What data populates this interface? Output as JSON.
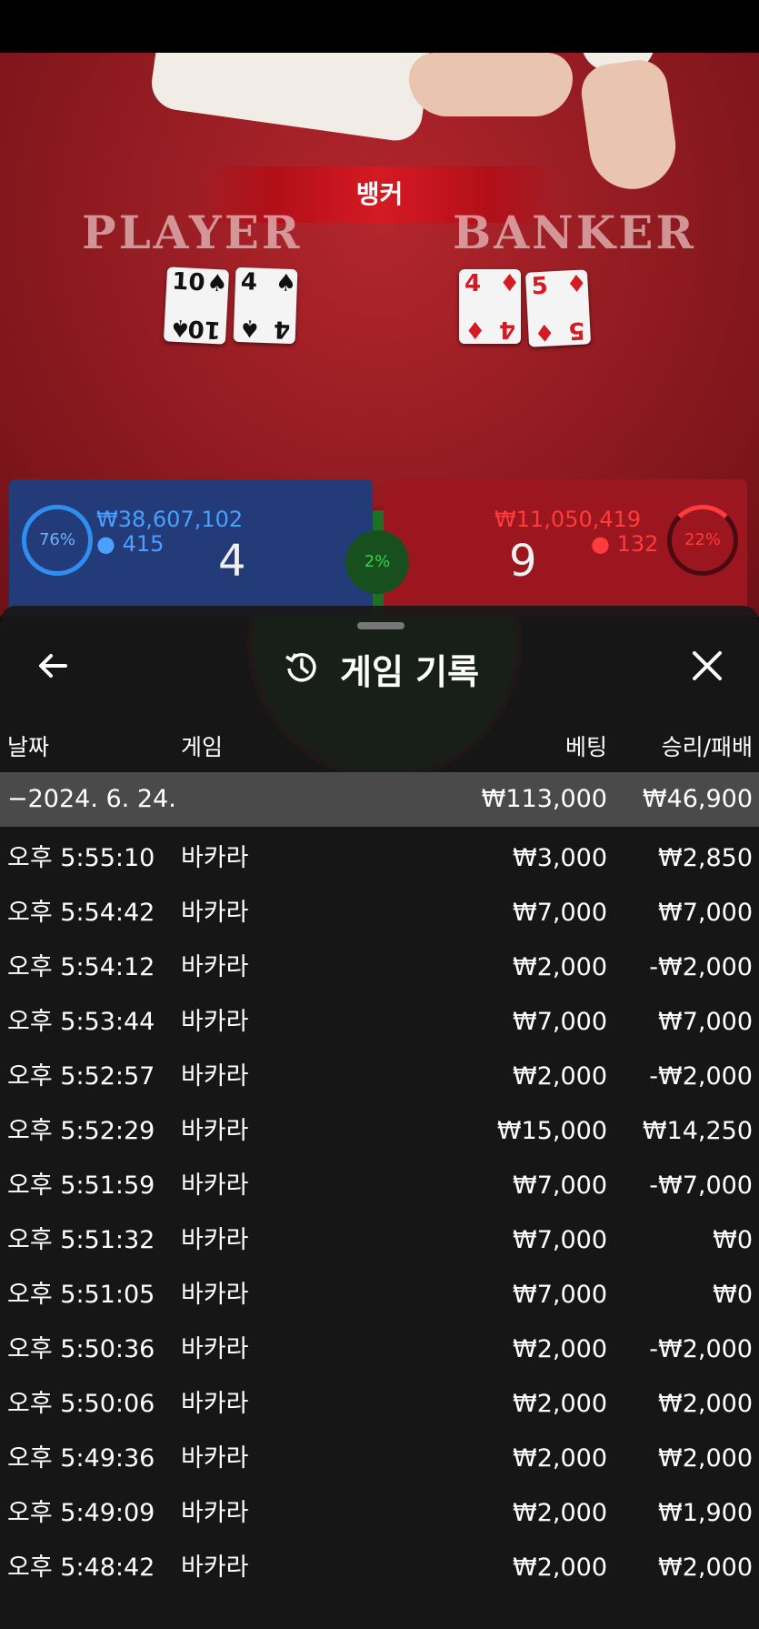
{
  "game_table": {
    "result_banner": "뱅커",
    "player_label": "PLAYER",
    "banker_label": "BANKER",
    "player_cards": [
      {
        "rank": "10",
        "suit": "♠",
        "color": "black"
      },
      {
        "rank": "4",
        "suit": "♠",
        "color": "black"
      }
    ],
    "banker_cards": [
      {
        "rank": "4",
        "suit": "♦",
        "color": "red"
      },
      {
        "rank": "5",
        "suit": "♦",
        "color": "red"
      }
    ],
    "player_stats": {
      "percent": "76%",
      "amount": "₩38,607,102",
      "bettors": "415",
      "score": "4"
    },
    "banker_stats": {
      "percent": "22%",
      "amount": "₩11,050,419",
      "bettors": "132",
      "score": "9"
    },
    "tie_percent": "2%"
  },
  "sheet": {
    "title": "게임 기록",
    "back_icon": "arrow-left-icon",
    "history_icon": "history-icon",
    "close_icon": "close-icon",
    "columns": {
      "date": "날짜",
      "game": "게임",
      "bet": "베팅",
      "result": "승리/패배"
    },
    "total_row": {
      "date": "−2024. 6. 24.",
      "bet": "₩113,000",
      "result": "₩46,900"
    },
    "rows": [
      {
        "time": "오후 5:55:10",
        "game": "바카라",
        "bet": "₩3,000",
        "result": "₩2,850"
      },
      {
        "time": "오후 5:54:42",
        "game": "바카라",
        "bet": "₩7,000",
        "result": "₩7,000"
      },
      {
        "time": "오후 5:54:12",
        "game": "바카라",
        "bet": "₩2,000",
        "result": "-₩2,000"
      },
      {
        "time": "오후 5:53:44",
        "game": "바카라",
        "bet": "₩7,000",
        "result": "₩7,000"
      },
      {
        "time": "오후 5:52:57",
        "game": "바카라",
        "bet": "₩2,000",
        "result": "-₩2,000"
      },
      {
        "time": "오후 5:52:29",
        "game": "바카라",
        "bet": "₩15,000",
        "result": "₩14,250"
      },
      {
        "time": "오후 5:51:59",
        "game": "바카라",
        "bet": "₩7,000",
        "result": "-₩7,000"
      },
      {
        "time": "오후 5:51:32",
        "game": "바카라",
        "bet": "₩7,000",
        "result": "₩0"
      },
      {
        "time": "오후 5:51:05",
        "game": "바카라",
        "bet": "₩7,000",
        "result": "₩0"
      },
      {
        "time": "오후 5:50:36",
        "game": "바카라",
        "bet": "₩2,000",
        "result": "-₩2,000"
      },
      {
        "time": "오후 5:50:06",
        "game": "바카라",
        "bet": "₩2,000",
        "result": "₩2,000"
      },
      {
        "time": "오후 5:49:36",
        "game": "바카라",
        "bet": "₩2,000",
        "result": "₩2,000"
      },
      {
        "time": "오후 5:49:09",
        "game": "바카라",
        "bet": "₩2,000",
        "result": "₩1,900"
      },
      {
        "time": "오후 5:48:42",
        "game": "바카라",
        "bet": "₩2,000",
        "result": "₩2,000"
      }
    ]
  }
}
